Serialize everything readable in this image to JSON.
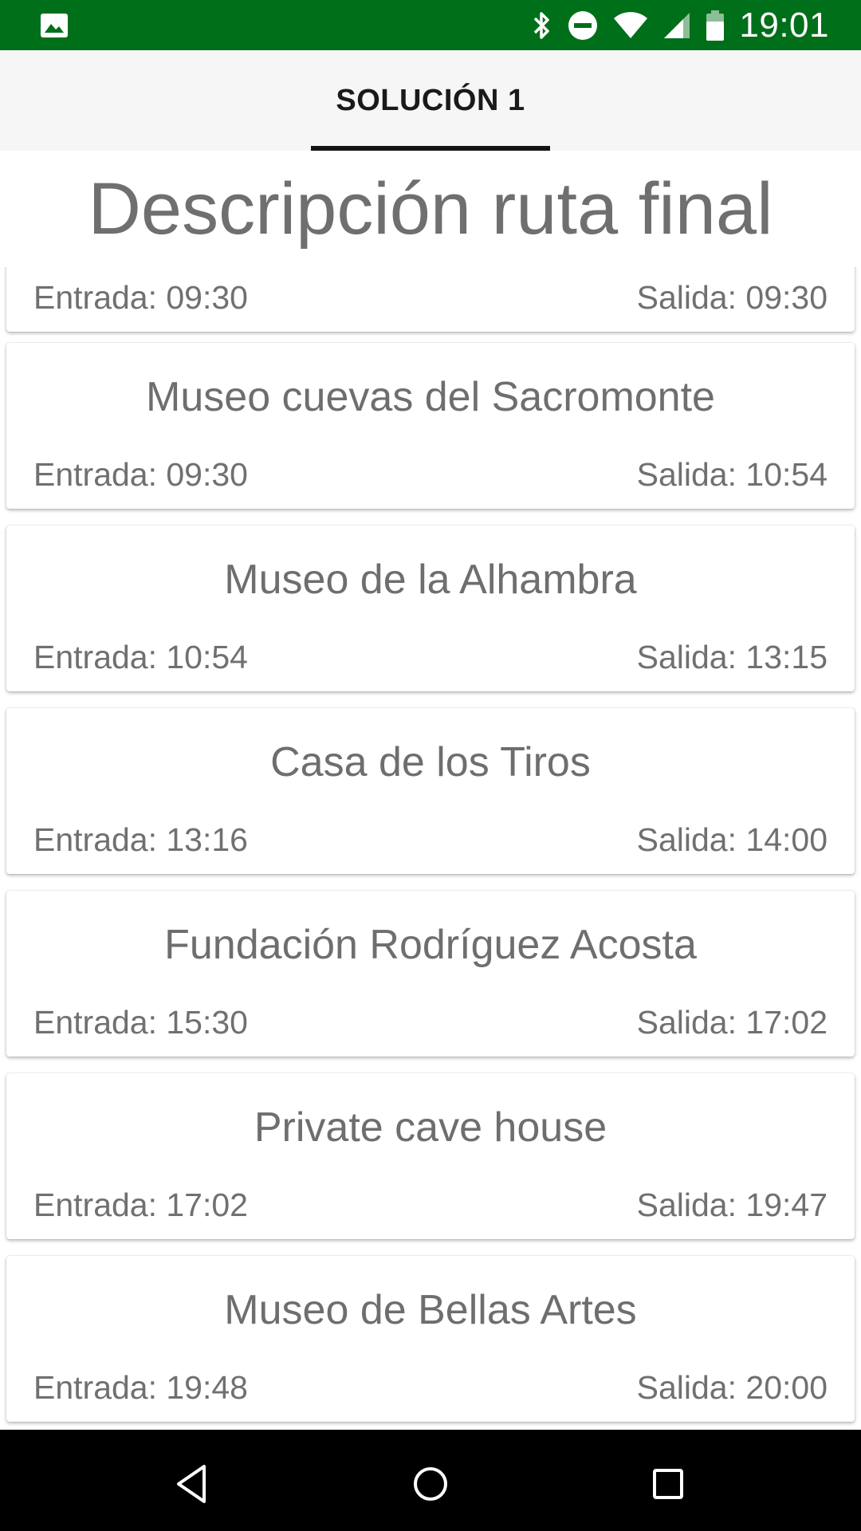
{
  "status_bar": {
    "time": "19:01",
    "icons": [
      "image-icon",
      "bluetooth-icon",
      "do-not-disturb-icon",
      "wifi-icon",
      "cell-signal-icon",
      "battery-icon"
    ],
    "background": "#006f1a"
  },
  "tabs": [
    {
      "label": "SOLUCIÓN 1",
      "active": true
    }
  ],
  "page_title": "Descripción ruta final",
  "stops": [
    {
      "name": "",
      "entrada": "Entrada: 09:30",
      "salida": "Salida: 09:30"
    },
    {
      "name": "Museo cuevas del Sacromonte",
      "entrada": "Entrada: 09:30",
      "salida": "Salida: 10:54"
    },
    {
      "name": "Museo de la Alhambra",
      "entrada": "Entrada: 10:54",
      "salida": "Salida: 13:15"
    },
    {
      "name": "Casa de los Tiros",
      "entrada": "Entrada: 13:16",
      "salida": "Salida: 14:00"
    },
    {
      "name": "Fundación Rodríguez Acosta",
      "entrada": "Entrada: 15:30",
      "salida": "Salida: 17:02"
    },
    {
      "name": "Private cave house",
      "entrada": "Entrada: 17:02",
      "salida": "Salida: 19:47"
    },
    {
      "name": "Museo de Bellas Artes",
      "entrada": "Entrada: 19:48",
      "salida": "Salida: 20:00"
    }
  ],
  "nav_bar": {
    "icons": [
      "back-icon",
      "home-icon",
      "recents-icon"
    ]
  }
}
